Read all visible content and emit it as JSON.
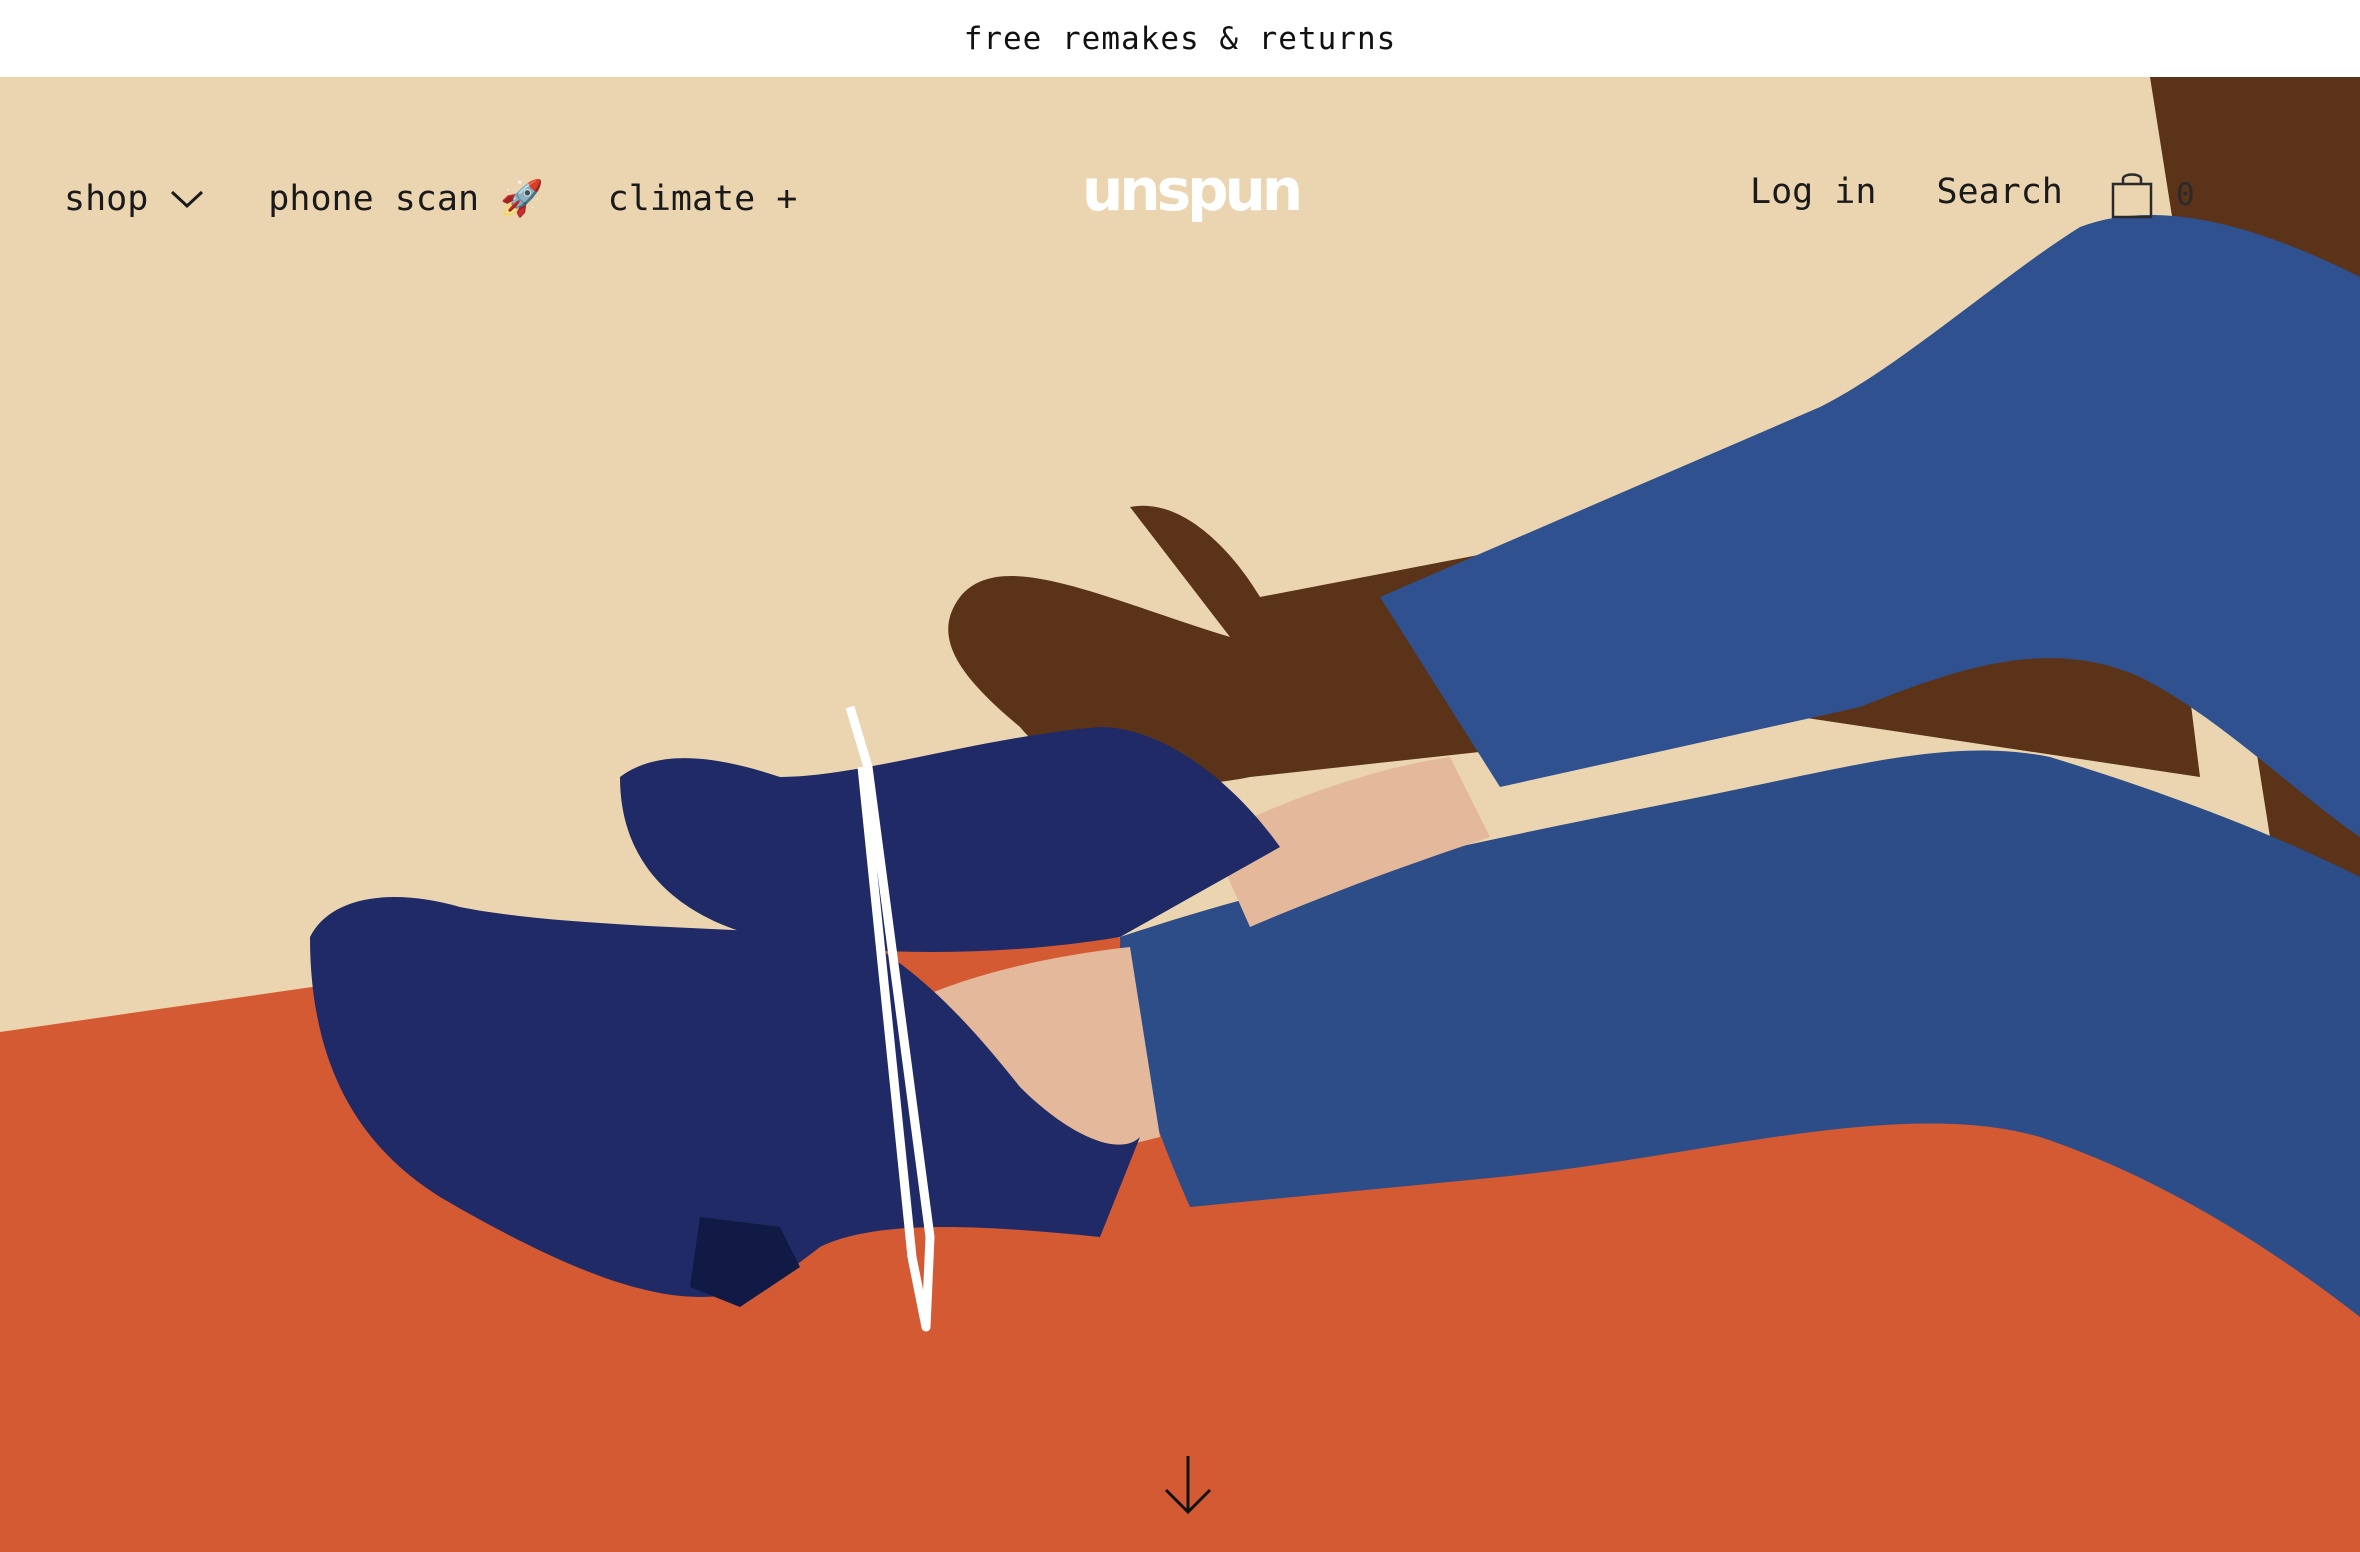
{
  "announcement": {
    "text": "free remakes & returns"
  },
  "nav": {
    "left": [
      {
        "label": "shop",
        "icon": "chevron-down-icon"
      },
      {
        "label": "phone scan 🚀"
      },
      {
        "label": "climate +"
      }
    ],
    "logo": "unspun",
    "right": {
      "login": "Log in",
      "search": "Search"
    },
    "cart": {
      "icon": "shopping-bag-icon",
      "count": "0"
    }
  },
  "hero": {
    "image": "model-legs-in-blue-jeans-and-navy-suede-boots",
    "scroll_icon": "arrow-down-icon"
  },
  "colors": {
    "wall": "#ead5b0",
    "floor": "#d35a33",
    "denim": "#30518f",
    "boot": "#1f2a66",
    "shadow": "#5a3318"
  }
}
